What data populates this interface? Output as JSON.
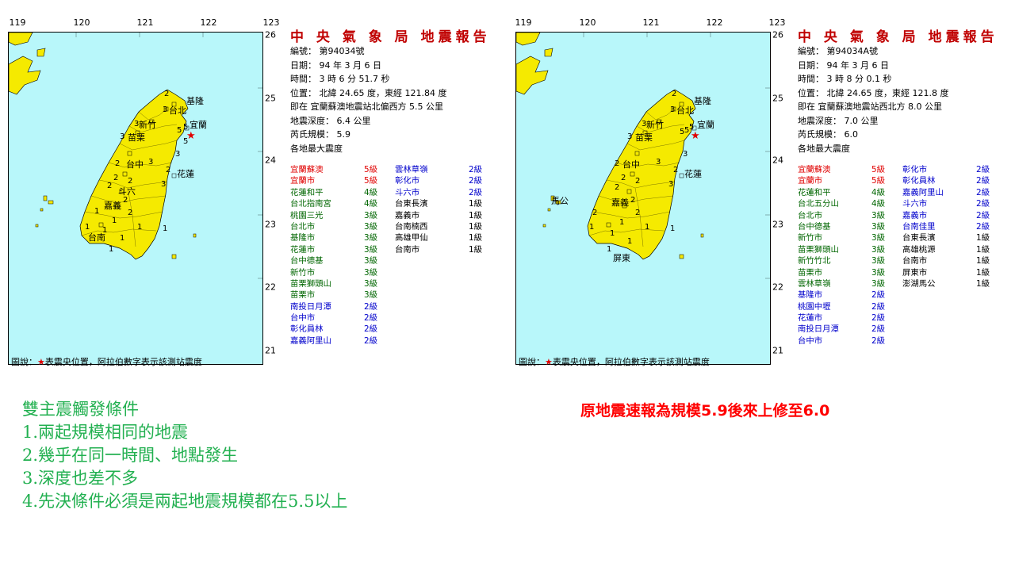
{
  "reports": [
    {
      "title": "中 央 氣 象 局 地震報告",
      "number": "編號： 第94034號",
      "date": "日期： 94 年 3 月 6 日",
      "time": "時間： 3 時 6 分 51.7 秒",
      "position": "位置： 北緯 24.65 度，東經 121.84 度",
      "near": "即在 宜蘭蘇澳地震站北偏西方 5.5 公里",
      "depth": "地震深度： 6.4 公里",
      "magnitude": "芮氏規模： 5.9",
      "max_intensity_label": "各地最大震度",
      "stations_col1": [
        {
          "name": "宜蘭蘇澳",
          "level": "5級",
          "color": "red"
        },
        {
          "name": "宜蘭市",
          "level": "5級",
          "color": "red"
        },
        {
          "name": "花蓮和平",
          "level": "4級",
          "color": "green"
        },
        {
          "name": "台北指南宮",
          "level": "4級",
          "color": "green"
        },
        {
          "name": "桃園三光",
          "level": "3級",
          "color": "green"
        },
        {
          "name": "台北市",
          "level": "3級",
          "color": "green"
        },
        {
          "name": "基隆市",
          "level": "3級",
          "color": "green"
        },
        {
          "name": "花蓮市",
          "level": "3級",
          "color": "green"
        },
        {
          "name": "台中德基",
          "level": "3級",
          "color": "green"
        },
        {
          "name": "新竹市",
          "level": "3級",
          "color": "green"
        },
        {
          "name": "苗栗獅頭山",
          "level": "3級",
          "color": "green"
        },
        {
          "name": "苗栗市",
          "level": "3級",
          "color": "green"
        },
        {
          "name": "南投日月潭",
          "level": "2級",
          "color": "blue"
        },
        {
          "name": "台中市",
          "level": "2級",
          "color": "blue"
        },
        {
          "name": "彰化員林",
          "level": "2級",
          "color": "blue"
        },
        {
          "name": "嘉義阿里山",
          "level": "2級",
          "color": "blue"
        }
      ],
      "stations_col2": [
        {
          "name": "雲林草嶺",
          "level": "2級",
          "color": "blue"
        },
        {
          "name": "彰化市",
          "level": "2級",
          "color": "blue"
        },
        {
          "name": "斗六市",
          "level": "2級",
          "color": "blue"
        },
        {
          "name": "台東長濱",
          "level": "1級",
          "color": "black"
        },
        {
          "name": "嘉義市",
          "level": "1級",
          "color": "black"
        },
        {
          "name": "台南楠西",
          "level": "1級",
          "color": "black"
        },
        {
          "name": "高雄甲仙",
          "level": "1級",
          "color": "black"
        },
        {
          "name": "台南市",
          "level": "1級",
          "color": "black"
        }
      ],
      "map": {
        "lon_ticks": [
          "119",
          "120",
          "121",
          "122",
          "123"
        ],
        "lat_ticks": [
          "26",
          "25",
          "24",
          "23",
          "22",
          "21"
        ],
        "cities": [
          "基隆",
          "台北",
          "新竹",
          "苗栗",
          "宜蘭",
          "台中",
          "斗六",
          "嘉義",
          "花蓮",
          "台南"
        ],
        "intensity_marks": [
          "2",
          "3",
          "3",
          "3",
          "5",
          "5",
          "5",
          "3",
          "2",
          "3",
          "2",
          "2",
          "2",
          "2",
          "3",
          "2",
          "2",
          "1",
          "1",
          "1",
          "1",
          "1",
          "1",
          "1",
          "1"
        ]
      },
      "legend_prefix": "圖說：",
      "legend_star": "★",
      "legend_text": "表震央位置，阿拉伯數字表示該測站震度"
    },
    {
      "title": "中 央 氣 象 局 地震報告",
      "number": "編號： 第94034A號",
      "date": "日期： 94 年 3 月 6 日",
      "time": "時間： 3 時 8 分 0.1 秒",
      "position": "位置： 北緯 24.65 度，東經 121.8 度",
      "near": "即在 宜蘭蘇澳地震站西北方 8.0 公里",
      "depth": "地震深度： 7.0 公里",
      "magnitude": "芮氏規模： 6.0",
      "max_intensity_label": "各地最大震度",
      "stations_col1": [
        {
          "name": "宜蘭蘇澳",
          "level": "5級",
          "color": "red"
        },
        {
          "name": "宜蘭市",
          "level": "5級",
          "color": "red"
        },
        {
          "name": "花蓮和平",
          "level": "4級",
          "color": "green"
        },
        {
          "name": "台北五分山",
          "level": "4級",
          "color": "green"
        },
        {
          "name": "台北市",
          "level": "3級",
          "color": "green"
        },
        {
          "name": "台中德基",
          "level": "3級",
          "color": "green"
        },
        {
          "name": "新竹市",
          "level": "3級",
          "color": "green"
        },
        {
          "name": "苗栗獅頭山",
          "level": "3級",
          "color": "green"
        },
        {
          "name": "新竹竹北",
          "level": "3級",
          "color": "green"
        },
        {
          "name": "苗栗市",
          "level": "3級",
          "color": "green"
        },
        {
          "name": "雲林草嶺",
          "level": "3級",
          "color": "green"
        },
        {
          "name": "基隆市",
          "level": "2級",
          "color": "blue"
        },
        {
          "name": "桃園中壢",
          "level": "2級",
          "color": "blue"
        },
        {
          "name": "花蓮市",
          "level": "2級",
          "color": "blue"
        },
        {
          "name": "南投日月潭",
          "level": "2級",
          "color": "blue"
        },
        {
          "name": "台中市",
          "level": "2級",
          "color": "blue"
        }
      ],
      "stations_col2": [
        {
          "name": "彰化市",
          "level": "2級",
          "color": "blue"
        },
        {
          "name": "彰化員林",
          "level": "2級",
          "color": "blue"
        },
        {
          "name": "嘉義阿里山",
          "level": "2級",
          "color": "blue"
        },
        {
          "name": "斗六市",
          "level": "2級",
          "color": "blue"
        },
        {
          "name": "嘉義市",
          "level": "2級",
          "color": "blue"
        },
        {
          "name": "台南佳里",
          "level": "2級",
          "color": "blue"
        },
        {
          "name": "台東長濱",
          "level": "1級",
          "color": "black"
        },
        {
          "name": "高雄桃源",
          "level": "1級",
          "color": "black"
        },
        {
          "name": "台南市",
          "level": "1級",
          "color": "black"
        },
        {
          "name": "屏東市",
          "level": "1級",
          "color": "black"
        },
        {
          "name": "澎湖馬公",
          "level": "1級",
          "color": "black"
        }
      ],
      "map": {
        "lon_ticks": [
          "119",
          "120",
          "121",
          "122",
          "123"
        ],
        "lat_ticks": [
          "26",
          "25",
          "24",
          "23",
          "22",
          "21"
        ],
        "cities": [
          "基隆",
          "台北",
          "新竹",
          "苗栗",
          "宜蘭",
          "台中",
          "嘉義",
          "花蓮",
          "屏東",
          "馬公"
        ],
        "intensity_marks": [
          "2",
          "3",
          "3",
          "3",
          "5",
          "5",
          "5",
          "3",
          "2",
          "3",
          "2",
          "2",
          "2",
          "2",
          "3",
          "2",
          "2",
          "2",
          "1",
          "1",
          "1",
          "1",
          "1",
          "1",
          "1"
        ]
      },
      "legend_prefix": "圖說：",
      "legend_star": "★",
      "legend_text": "表震央位置，阿拉伯數字表示該測站震度"
    }
  ],
  "conditions": {
    "title": "雙主震觸發條件",
    "items": [
      "1.兩起規模相同的地震",
      "2.幾乎在同一時間、地點發生",
      "3.深度也差不多",
      "4.先決條件必須是兩起地震規模都在5.5以上"
    ]
  },
  "note": "原地震速報為規模5.9後來上修至6.0",
  "colors": {
    "red": "#e00000",
    "green": "#006600",
    "blue": "#0000cc",
    "black": "#000000",
    "sea": "#b8f7fa",
    "land": "#f5ea00",
    "conditions": "#22b050",
    "note": "#ff0000"
  }
}
